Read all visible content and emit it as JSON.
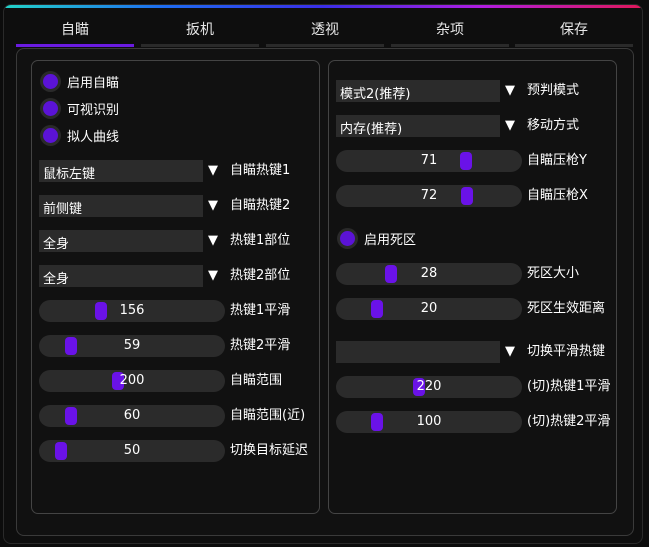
{
  "tabs": [
    {
      "label": "自瞄",
      "active": true
    },
    {
      "label": "扳机",
      "active": false
    },
    {
      "label": "透视",
      "active": false
    },
    {
      "label": "杂项",
      "active": false
    },
    {
      "label": "保存",
      "active": false
    }
  ],
  "left": {
    "checkboxes": [
      {
        "label": "启用自瞄",
        "checked": true
      },
      {
        "label": "可视识别",
        "checked": true
      },
      {
        "label": "拟人曲线",
        "checked": true
      }
    ],
    "combos": [
      {
        "value": "鼠标左键",
        "label": "自瞄热键1"
      },
      {
        "value": "前侧键",
        "label": "自瞄热键2"
      },
      {
        "value": "全身",
        "label": "热键1部位"
      },
      {
        "value": "全身",
        "label": "热键2部位"
      }
    ],
    "sliders": [
      {
        "value": "156",
        "label": "热键1平滑",
        "fraction": 0.32
      },
      {
        "value": "59",
        "label": "热键2平滑",
        "fraction": 0.15
      },
      {
        "value": "200",
        "label": "自瞄范围",
        "fraction": 0.42
      },
      {
        "value": "60",
        "label": "自瞄范围(近)",
        "fraction": 0.15
      },
      {
        "value": "50",
        "label": "切换目标延迟",
        "fraction": 0.09
      }
    ]
  },
  "right": {
    "combos": [
      {
        "value": "模式2(推荐)",
        "label": "预判模式"
      },
      {
        "value": "内存(推荐)",
        "label": "移动方式"
      }
    ],
    "sliders_a": [
      {
        "value": "71",
        "label": "自瞄压枪Y",
        "fraction": 0.71
      },
      {
        "value": "72",
        "label": "自瞄压枪X",
        "fraction": 0.72
      }
    ],
    "checkbox": {
      "label": "启用死区",
      "checked": true
    },
    "sliders_b": [
      {
        "value": "28",
        "label": "死区大小",
        "fraction": 0.28
      },
      {
        "value": "20",
        "label": "死区生效距离",
        "fraction": 0.2
      }
    ],
    "combo_hotkey": {
      "value": "",
      "label": "切换平滑热键"
    },
    "sliders_c": [
      {
        "value": "220",
        "label": "(切)热键1平滑",
        "fraction": 0.44
      },
      {
        "value": "100",
        "label": "(切)热键2平滑",
        "fraction": 0.2
      }
    ]
  },
  "icons": {
    "arrow": "▼"
  },
  "colors": {
    "accent": "#6a12e8",
    "tab_active": "#6a1be0",
    "control_bg": "#2b2b2b"
  }
}
